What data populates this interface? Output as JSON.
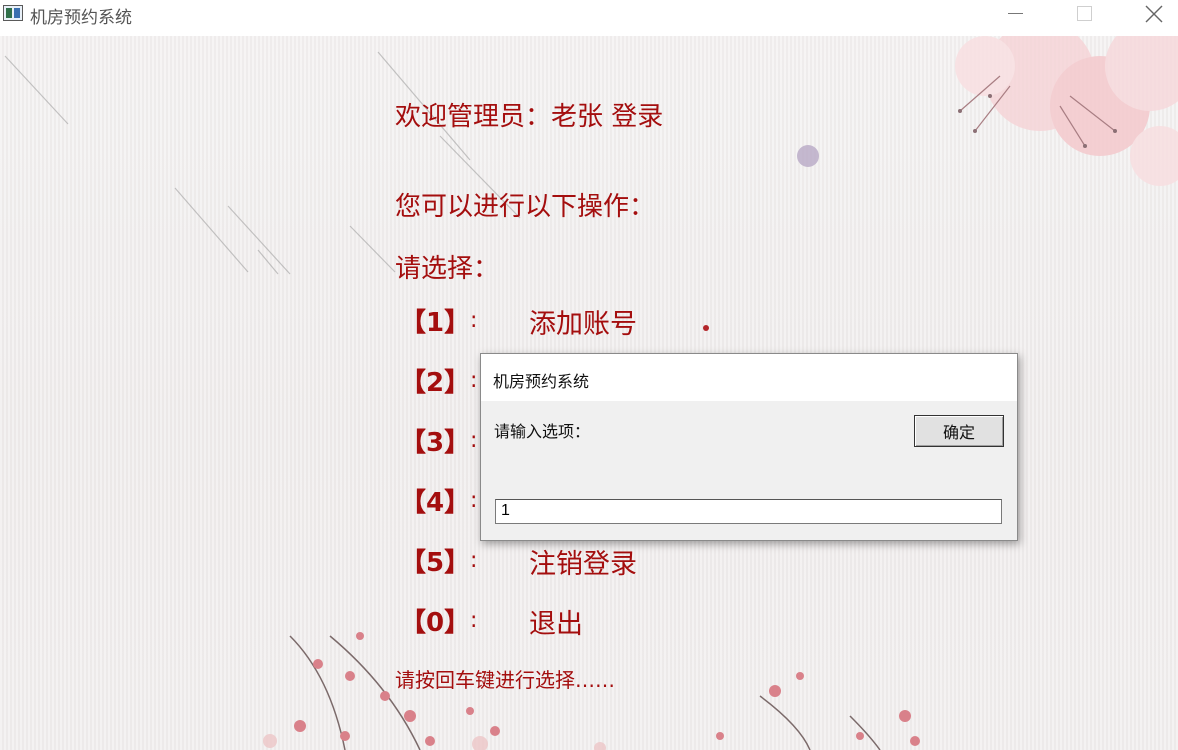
{
  "window": {
    "title": "机房预约系统",
    "controls": [
      "minimize",
      "maximize",
      "close"
    ]
  },
  "screen": {
    "welcome": "欢迎管理员：老张    登录",
    "prompt_operations": "您可以进行以下操作：",
    "prompt_select": "请选择：",
    "options": [
      {
        "key": "【1】",
        "colon": ":",
        "label": "添加账号"
      },
      {
        "key": "【2】",
        "colon": ":",
        "label": ""
      },
      {
        "key": "【3】",
        "colon": ":",
        "label": ""
      },
      {
        "key": "【4】",
        "colon": ":",
        "label": ""
      },
      {
        "key": "【5】",
        "colon": ":",
        "label": "注销登录"
      },
      {
        "key": "【0】",
        "colon": ":",
        "label": "退出"
      }
    ],
    "footer_tip": "请按回车键进行选择……"
  },
  "dialog": {
    "title": "机房预约系统",
    "message": "请输入选项：",
    "ok_label": "确定",
    "input_value": "1"
  },
  "colors": {
    "text_accent": "#a40e0e",
    "dialog_bg": "#f0f0f0"
  }
}
